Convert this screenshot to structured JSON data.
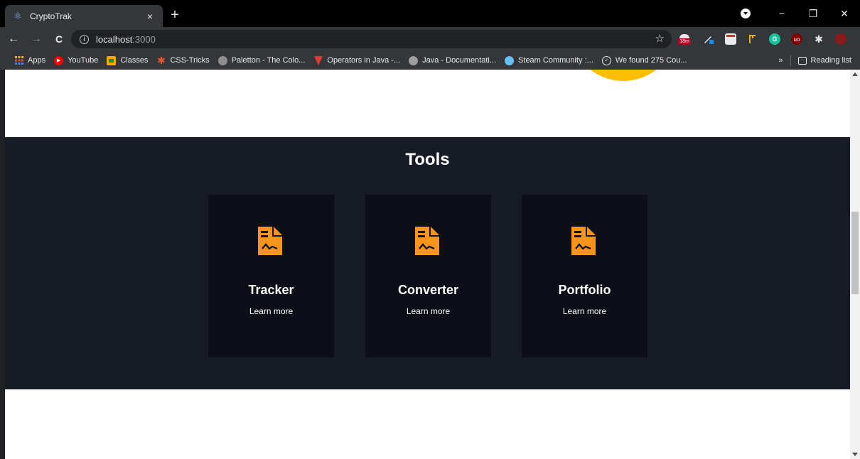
{
  "browser": {
    "tab_title": "CryptoTrak",
    "tab_close": "×",
    "new_tab": "+",
    "window_controls": {
      "minimize": "−",
      "restore": "❐",
      "close": "✕"
    },
    "nav": {
      "back": "←",
      "forward": "→",
      "reload": "C"
    },
    "url_host": "localhost",
    "url_port": ":3000",
    "extensions": [
      {
        "name": "grammarly",
        "label": "G"
      },
      {
        "name": "ublock",
        "label": "uo"
      }
    ],
    "extension_badge": "18m",
    "menu": "⋮"
  },
  "bookmarks": {
    "items": [
      {
        "label": "Apps",
        "icon": "apps-grid-icon",
        "color": "#f4b400"
      },
      {
        "label": "YouTube",
        "icon": "youtube-icon",
        "color": "#ff0000"
      },
      {
        "label": "Classes",
        "icon": "classroom-icon",
        "color": "#f9ab00"
      },
      {
        "label": "CSS-Tricks",
        "icon": "css-tricks-icon",
        "color": "#e8562d"
      },
      {
        "label": "Paletton - The Colo...",
        "icon": "paletton-icon",
        "color": "#8e8e8e"
      },
      {
        "label": "Operators in Java -...",
        "icon": "vk-icon",
        "color": "#e53935"
      },
      {
        "label": "Java - Documentati...",
        "icon": "java-doc-icon",
        "color": "#9e9e9e"
      },
      {
        "label": "Steam Community :...",
        "icon": "steam-icon",
        "color": "#66c0f4"
      },
      {
        "label": "We found 275 Cou...",
        "icon": "clock-check-icon",
        "color": "#e8eaed"
      }
    ],
    "more": "»",
    "reading_list": "Reading list"
  },
  "page": {
    "tools_title": "Tools",
    "cards": [
      {
        "title": "Tracker",
        "link": "Learn more"
      },
      {
        "title": "Converter",
        "link": "Learn more"
      },
      {
        "title": "Portfolio",
        "link": "Learn more"
      }
    ],
    "colors": {
      "accent": "#f7941d",
      "hero": "#fcbd05",
      "section_bg": "#161b26",
      "card_bg": "#0c0f17"
    }
  }
}
